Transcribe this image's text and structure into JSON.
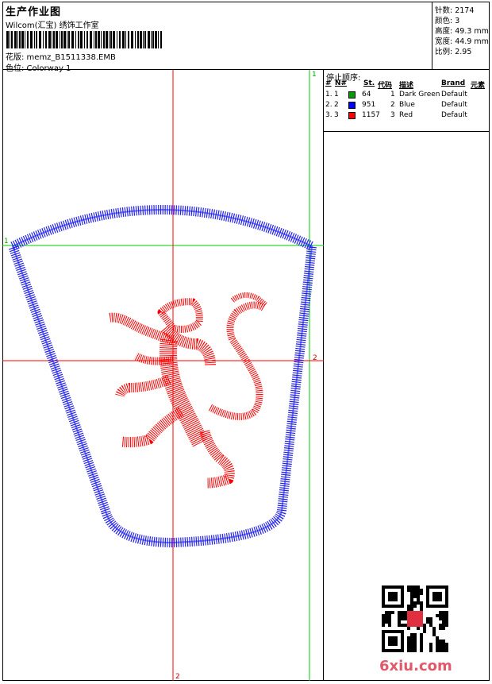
{
  "header": {
    "title": "生产作业图",
    "studio": "Wilcom(汇宝) 绣饰工作室",
    "design_file": "花版:  memz_B1511338.EMB",
    "colorway": "色位:  Colorway 1"
  },
  "stats": {
    "stitches": "针数: 2174",
    "colors": "颜色: 3",
    "height": "高度: 49.3 mm",
    "width": "宽度: 44.9 mm",
    "scale": "比例: 2.95"
  },
  "stop_sequence": {
    "title": "停止顺序:",
    "headers": [
      "#",
      "N#",
      "St.",
      "代码",
      "描述",
      "Brand",
      "元素"
    ],
    "rows": [
      {
        "idx": "1.",
        "n": "1",
        "st": "64",
        "code": "1",
        "desc": "Dark Green",
        "brand": "Default",
        "color": "#00a000"
      },
      {
        "idx": "2.",
        "n": "2",
        "st": "951",
        "code": "2",
        "desc": "Blue",
        "brand": "Default",
        "color": "#0000ff"
      },
      {
        "idx": "3.",
        "n": "3",
        "st": "1157",
        "code": "3",
        "desc": "Red",
        "brand": "Default",
        "color": "#ff0000"
      }
    ]
  },
  "markers": {
    "green_h": "1",
    "green_v": "1",
    "red_h": "2",
    "red_v": "2"
  },
  "watermark": "6xiu.com",
  "colors": {
    "green_guide": "#00cc00",
    "red_guide": "#ff0000",
    "outline": "#2222ee",
    "lion": "#ff0000"
  }
}
